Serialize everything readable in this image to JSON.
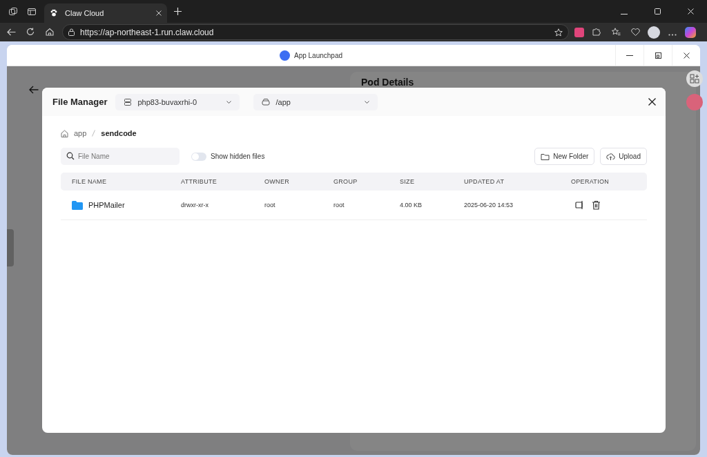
{
  "browser": {
    "tab_title": "Claw Cloud",
    "url": "https://ap-northeast-1.run.claw.cloud"
  },
  "window": {
    "title": "App Launchpad"
  },
  "background": {
    "card_title": "Pod Details"
  },
  "file_manager": {
    "title": "File Manager",
    "pod_select": "php83-buvaxrhi-0",
    "path_select": "/app",
    "breadcrumb": [
      {
        "label": "app",
        "current": false
      },
      {
        "label": "sendcode",
        "current": true
      }
    ],
    "search": {
      "placeholder": "File Name"
    },
    "hidden_toggle": {
      "label": "Show hidden files",
      "on": false
    },
    "buttons": [
      {
        "kind": "folder",
        "label": "New Folder"
      },
      {
        "kind": "upload",
        "label": "Upload"
      }
    ],
    "table": {
      "columns": [
        "FILE NAME",
        "ATTRIBUTE",
        "OWNER",
        "GROUP",
        "SIZE",
        "UPDATED AT",
        "OPERATION"
      ],
      "rows": [
        {
          "kind": "folder",
          "name": "PHPMailer",
          "attribute": "drwxr-xr-x",
          "owner": "root",
          "group": "root",
          "size": "4.00 KB",
          "updated": "2025-06-20 14:53"
        }
      ]
    }
  }
}
